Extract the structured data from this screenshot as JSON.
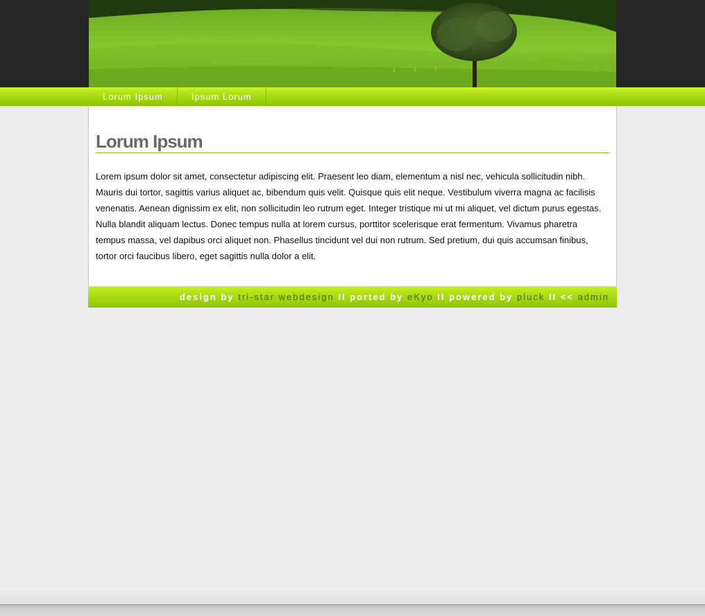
{
  "nav": {
    "items": [
      {
        "label": "Lorum Ipsum"
      },
      {
        "label": "Ipsum Lorum"
      }
    ]
  },
  "main": {
    "title": "Lorum Ipsum",
    "body": "Lorem ipsum dolor sit amet, consectetur adipiscing elit. Praesent leo diam, elementum a nisl nec, vehicula sollicitudin nibh. Mauris dui tortor, sagittis varius aliquet ac, bibendum quis velit. Quisque quis elit neque. Vestibulum viverra magna ac facilisis venenatis. Aenean dignissim ex elit, non sollicitudin leo rutrum eget. Integer tristique mi ut mi aliquet, vel dictum purus egestas. Nulla blandit aliquam lectus. Donec tempus nulla at lorem cursus, porttitor scelerisque erat fermentum. Vivamus pharetra tempus massa, vel dapibus orci aliquet non. Phasellus tincidunt vel dui non rutrum. Sed pretium, dui quis accumsan finibus, tortor orci faucibus libero, eget sagittis nulla dolor a elit."
  },
  "footer": {
    "design_by_text": "design by ",
    "tristar_link": "tri-star webdesign",
    "sep1": " II ",
    "ported_by_text": "ported by ",
    "ekyo_link": "eKyo",
    "sep2": " II ",
    "powered_by_text": "powered by ",
    "pluck_link": "pluck",
    "sep3": " II ",
    "back_arrows": "<< ",
    "admin_link": "admin"
  },
  "colors": {
    "accent_green": "#a9dc12",
    "link_dark_green": "#4a6e00",
    "title_gray": "#6a6a6a",
    "header_dark": "#262626",
    "background": "#ededed"
  },
  "icons": [
    "header-landscape-image"
  ]
}
